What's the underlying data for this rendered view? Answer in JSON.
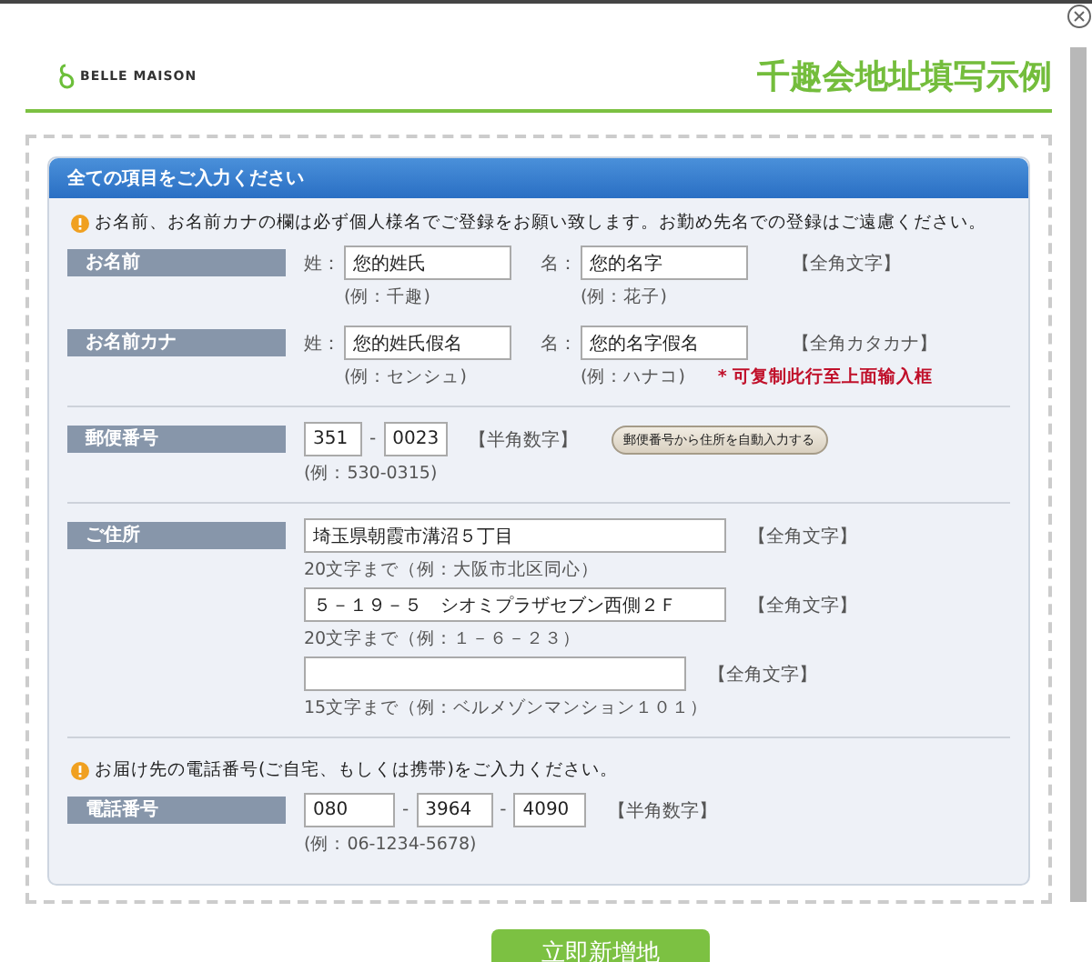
{
  "logo": "BELLE MAISON",
  "title": "千趣会地址填写示例",
  "panel_title": "全ての項目をご入力ください",
  "notice_1": "お名前、お名前カナの欄は必ず個人様名でご登録をお願い致します。お勤め先名での登録はご遠慮ください。",
  "rows": [
    {
      "kind": "name",
      "label": "お名前",
      "parts": [
        {
          "prefix": "姓：",
          "value": "您的姓氏",
          "example": "(例：千趣)"
        },
        {
          "prefix": "名：",
          "value": "您的名字",
          "example": "(例：花子)"
        }
      ],
      "hint": "【全角文字】"
    },
    {
      "kind": "name",
      "label": "お名前カナ",
      "parts": [
        {
          "prefix": "姓：",
          "value": "您的姓氏假名",
          "example": "(例：センシュ)"
        },
        {
          "prefix": "名：",
          "value": "您的名字假名",
          "example": "(例：ハナコ)"
        }
      ],
      "hint": "【全角カタカナ】",
      "note": "* 可复制此行至上面输入框"
    },
    {
      "kind": "zip",
      "label": "郵便番号",
      "values": [
        "351",
        "0023"
      ],
      "separator": "-",
      "hint": "【半角数字】",
      "button": "郵便番号から住所を自動入力する",
      "example": "(例：530-0315)"
    },
    {
      "kind": "address",
      "label": "ご住所",
      "lines": [
        {
          "value": "埼玉県朝霞市溝沼５丁目",
          "hint": "【全角文字】",
          "note": "20文字まで（例：大阪市北区同心）"
        },
        {
          "value": "５－１９－５　シオミプラザセブン西側２Ｆ",
          "hint": "【全角文字】",
          "note": "20文字まで（例：１－６－２３）"
        },
        {
          "hint": "【全角文字】",
          "note": "15文字まで（例：ベルメゾンマンション１０１）"
        }
      ]
    },
    {
      "kind": "notice",
      "text": "お届け先の電話番号(ご自宅、もしくは携帯)をご入力ください。"
    },
    {
      "kind": "phone",
      "label": "電話番号",
      "values": [
        "080",
        "3964",
        "4090"
      ],
      "separator": "-",
      "hint": "【半角数字】",
      "example": "(例：06-1234-5678)"
    }
  ],
  "submit": "立即新增地"
}
